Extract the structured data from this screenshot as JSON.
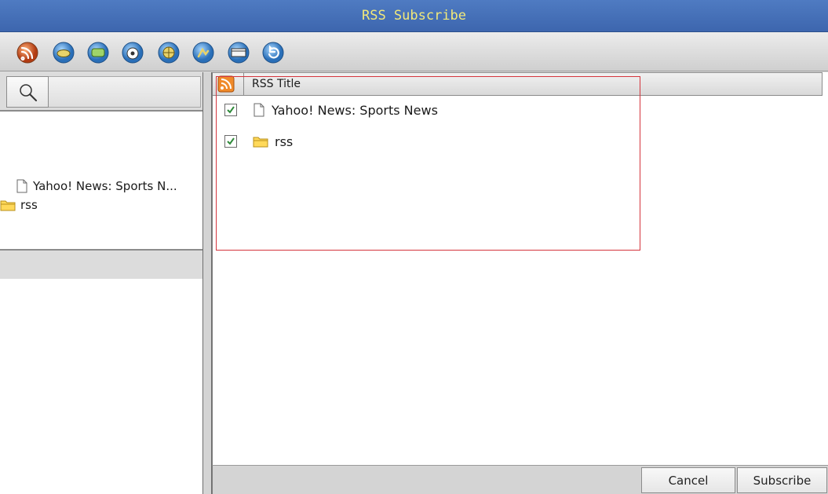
{
  "window": {
    "title": "RSS Subscribe"
  },
  "toolbar": {
    "buttons": [
      {
        "icon": "rss-feed-icon",
        "color": "#c8501e"
      },
      {
        "icon": "news-icon",
        "color": "#3c8ad4"
      },
      {
        "icon": "globe-icon",
        "color": "#3c8ad4"
      },
      {
        "icon": "soccer-icon",
        "color": "#3c8ad4"
      },
      {
        "icon": "world-icon",
        "color": "#3c8ad4"
      },
      {
        "icon": "sports-icon",
        "color": "#3c8ad4"
      },
      {
        "icon": "browser-icon",
        "color": "#3c8ad4"
      },
      {
        "icon": "refresh-icon",
        "color": "#3c8ad4"
      }
    ]
  },
  "sidebar": {
    "search": {
      "icon": "search-icon",
      "value": ""
    },
    "items": [
      {
        "label": "Yahoo! News: Sports N...",
        "icon": "file-icon"
      },
      {
        "label": "rss",
        "icon": "folder-icon"
      }
    ]
  },
  "table": {
    "header": {
      "title": "RSS Title",
      "icon": "rss-icon"
    },
    "rows": [
      {
        "title": "Yahoo! News: Sports News",
        "checked": true,
        "icon": "file-icon"
      },
      {
        "title": "rss",
        "checked": true,
        "icon": "folder-icon"
      }
    ]
  },
  "footer": {
    "cancel_label": "Cancel",
    "subscribe_label": "Subscribe"
  },
  "colors": {
    "title_bar": "#4a76bd",
    "title_text": "#f2e97a",
    "highlight": "#d4343c",
    "check": "#2f8a3a"
  }
}
